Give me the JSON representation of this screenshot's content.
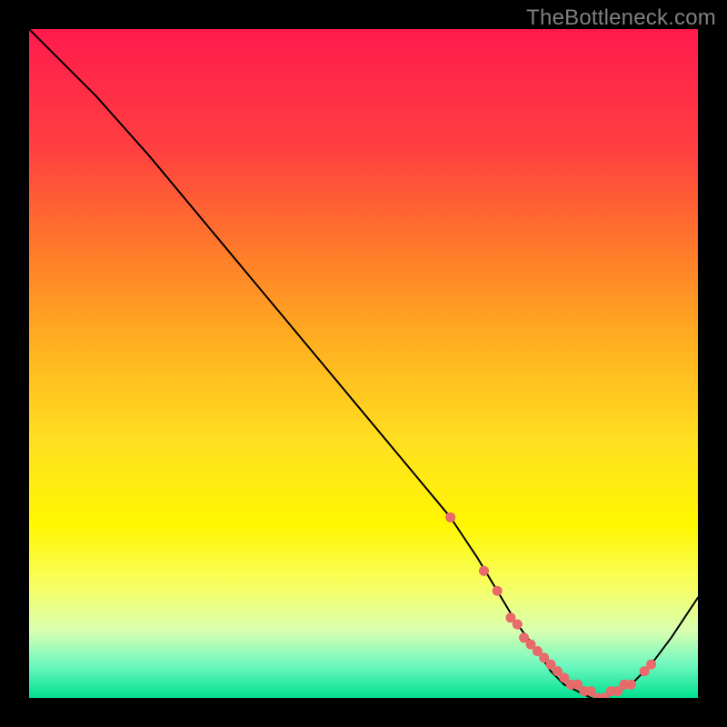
{
  "watermark": "TheBottleneck.com",
  "chart_data": {
    "type": "line",
    "title": "",
    "xlabel": "",
    "ylabel": "",
    "xlim": [
      0,
      100
    ],
    "ylim": [
      0,
      100
    ],
    "background": "rainbow-vertical-gradient",
    "series": [
      {
        "name": "curve",
        "x": [
          0,
          4,
          10,
          18,
          28,
          38,
          48,
          58,
          63,
          67,
          70,
          73,
          76,
          78,
          80,
          82,
          84,
          86,
          88,
          90,
          93,
          96,
          100
        ],
        "y": [
          100,
          96,
          90,
          81,
          69,
          57,
          45,
          33,
          27,
          21,
          16,
          11,
          7,
          4,
          2,
          1,
          0,
          0,
          1,
          2,
          5,
          9,
          15
        ]
      }
    ],
    "markers": {
      "name": "highlight-points",
      "color": "#e86a6a",
      "x": [
        63,
        68,
        70,
        72,
        73,
        74,
        75,
        76,
        77,
        78,
        79,
        80,
        81,
        82,
        83,
        84,
        85,
        86,
        87,
        88,
        89,
        90,
        92,
        93
      ],
      "y": [
        27,
        19,
        16,
        12,
        11,
        9,
        8,
        7,
        6,
        5,
        4,
        3,
        2,
        2,
        1,
        1,
        0,
        0,
        1,
        1,
        2,
        2,
        4,
        5
      ]
    }
  }
}
